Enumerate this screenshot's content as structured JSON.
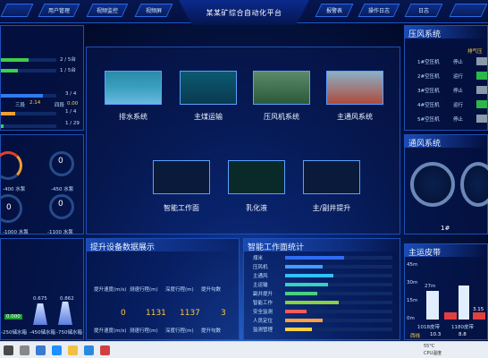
{
  "app": {
    "title": "某某矿综合自动化平台"
  },
  "nav": {
    "left": [
      "用户管理",
      "视频监控",
      "视频屏"
    ],
    "right": [
      "报警表",
      "操作日志",
      "日志"
    ]
  },
  "left": {
    "rows": [
      {
        "label": "2 / 5台"
      },
      {
        "label": "1 / 5台"
      },
      {
        "label": "3 / 4"
      },
      {
        "label": "1 / 4"
      },
      {
        "label": "1 / 29"
      }
    ],
    "mid_labels": {
      "a": "三段",
      "b": "2.14",
      "c": "四段",
      "d": "0.00"
    },
    "gauges": [
      {
        "val": "0",
        "unit": "",
        "cap": "-400 水泵"
      },
      {
        "val": "0",
        "cap": "-450 水泵"
      },
      {
        "val": "0",
        "cap": "-1000 水泵"
      },
      {
        "val": "0",
        "cap": "-1100 水泵"
      }
    ],
    "bottom": {
      "vals": [
        "0.000",
        "0.675",
        "0.862"
      ],
      "caps": [
        "-250储水箱",
        "-450储水箱",
        "-750储水箱"
      ]
    }
  },
  "center": {
    "systems": [
      {
        "label": "排水系统"
      },
      {
        "label": "主煤运输"
      },
      {
        "label": "压风机系统"
      },
      {
        "label": "主通风系统"
      }
    ],
    "systems2": [
      {
        "label": "智能工作面"
      },
      {
        "label": "乳化液"
      },
      {
        "label": "主/副井提升"
      }
    ]
  },
  "hoist": {
    "title": "提升设备数据展示",
    "heads": [
      "提升速度(m/s)",
      "测速行程(m)",
      "深度行程(m)",
      "提升勾数"
    ],
    "vals": [
      "0",
      "1131",
      "1137",
      "3"
    ],
    "subheads": [
      "提升速度(m/s)",
      "测速行程(m)",
      "深度行程(m)",
      "提升勾数"
    ]
  },
  "work": {
    "title": "智能工作面统计",
    "rows": [
      {
        "name": "煤米",
        "pct": 0.55,
        "color": "#2f6cf0"
      },
      {
        "name": "压风机",
        "pct": 0.35,
        "color": "#3fa0ff"
      },
      {
        "name": "主通风",
        "pct": 0.45,
        "color": "#32c0ff"
      },
      {
        "name": "主运输",
        "pct": 0.4,
        "color": "#38d0c0"
      },
      {
        "name": "副井提升",
        "pct": 0.3,
        "color": "#4ad080"
      },
      {
        "name": "智能工作",
        "pct": 0.5,
        "color": "#8ad040"
      },
      {
        "name": "安全监测",
        "pct": 0.2,
        "color": "#ff5a5a"
      },
      {
        "name": "人员定位",
        "pct": 0.35,
        "color": "#ffa040"
      },
      {
        "name": "监测管理",
        "pct": 0.25,
        "color": "#ffd040"
      }
    ]
  },
  "air": {
    "title": "压风系统",
    "head": "排气压",
    "rows": [
      {
        "name": "1#空压机",
        "state": "停止"
      },
      {
        "name": "2#空压机",
        "state": "运行"
      },
      {
        "name": "3#空压机",
        "state": "停止"
      },
      {
        "name": "4#空压机",
        "state": "运行"
      },
      {
        "name": "5#空压机",
        "state": "停止"
      }
    ]
  },
  "vent": {
    "title": "通风系统",
    "label": "1#"
  },
  "belt": {
    "title": "主运皮带",
    "ytick": [
      "45m",
      "30m",
      "15m",
      "0m"
    ],
    "vals": [
      "27m",
      "",
      "3.15"
    ],
    "bottom": [
      "1018皮带",
      "1180皮带",
      "..."
    ],
    "footer": [
      "西线",
      "10.3",
      "8.8"
    ]
  },
  "taskbar": {
    "time": "CPU温度",
    "temp": "55°C"
  }
}
